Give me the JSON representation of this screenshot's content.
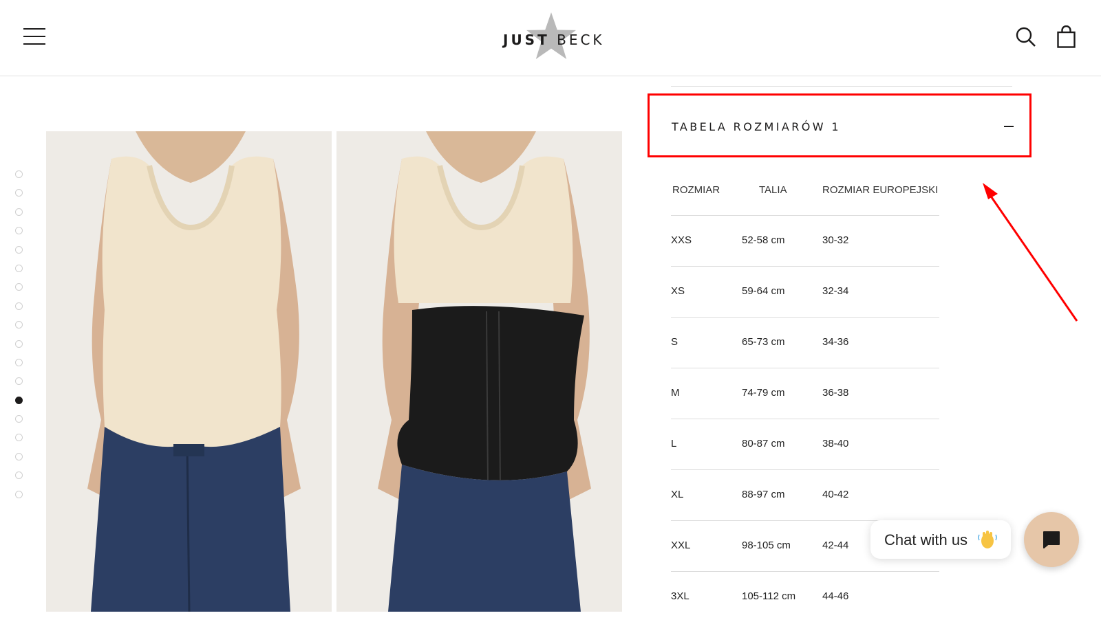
{
  "header": {
    "menu_icon": "hamburger-icon",
    "logo_text_bold": "JUST",
    "logo_text_light": "BECK",
    "search_icon": "search-icon",
    "cart_icon": "shopping-bag-icon"
  },
  "gallery": {
    "dot_count": 18,
    "active_dot_index": 12,
    "images": [
      {
        "subject": "woman-tank-top-before"
      },
      {
        "subject": "woman-tank-top-with-corset-after"
      }
    ]
  },
  "size_chart": {
    "accordion_title": "TABELA ROZMIARÓW 1",
    "toggle_icon": "minus-icon",
    "columns": [
      "ROZMIAR",
      "TALIA",
      "ROZMIAR EUROPEJSKI"
    ],
    "rows": [
      [
        "XXS",
        "52-58 cm",
        "30-32"
      ],
      [
        "XS",
        "59-64 cm",
        "32-34"
      ],
      [
        "S",
        "65-73 cm",
        "34-36"
      ],
      [
        "M",
        "74-79 cm",
        "36-38"
      ],
      [
        "L",
        "80-87 cm",
        "38-40"
      ],
      [
        "XL",
        "88-97 cm",
        "40-42"
      ],
      [
        "XXL",
        "98-105 cm",
        "42-44"
      ],
      [
        "3XL",
        "105-112 cm",
        "44-46"
      ]
    ]
  },
  "annotation": {
    "highlight_color": "#ff0000",
    "arrow_icon": "red-arrow-icon"
  },
  "chat": {
    "bubble_text": "Chat with us",
    "bubble_emoji_icon": "waving-hand-icon",
    "launcher_icon": "chat-bubble-icon",
    "launcher_color": "#e6c6a8"
  }
}
